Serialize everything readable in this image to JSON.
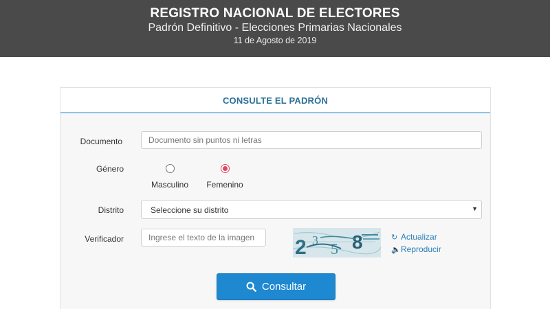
{
  "header": {
    "title": "REGISTRO NACIONAL DE ELECTORES",
    "subtitle": "Padrón Definitivo - Elecciones Primarias Nacionales",
    "date": "11 de Agosto de 2019"
  },
  "form": {
    "title": "CONSULTE EL PADRÓN",
    "documento": {
      "label": "Documento",
      "value": "",
      "placeholder": "Documento sin puntos ni letras"
    },
    "genero": {
      "label": "Género",
      "options": [
        "Masculino",
        "Femenino"
      ],
      "selected": "Femenino"
    },
    "distrito": {
      "label": "Distrito",
      "selected_label": "Seleccione su distrito"
    },
    "verificador": {
      "label": "Verificador",
      "value": "",
      "placeholder": "Ingrese el texto de la imagen",
      "captcha_text": "2358",
      "actualizar_label": "Actualizar",
      "reproducir_label": "Reproducir"
    },
    "submit_label": "Consultar"
  },
  "colors": {
    "header_bg": "#4a4a4a",
    "panel_title": "#2a6f97",
    "button": "#1e88d0",
    "radio_selected": "#e0475d",
    "link": "#2a7fb8"
  },
  "icons": {
    "refresh": "refresh-icon",
    "audio": "volume-icon",
    "search": "search-icon",
    "select_caret": "caret-down-icon"
  }
}
